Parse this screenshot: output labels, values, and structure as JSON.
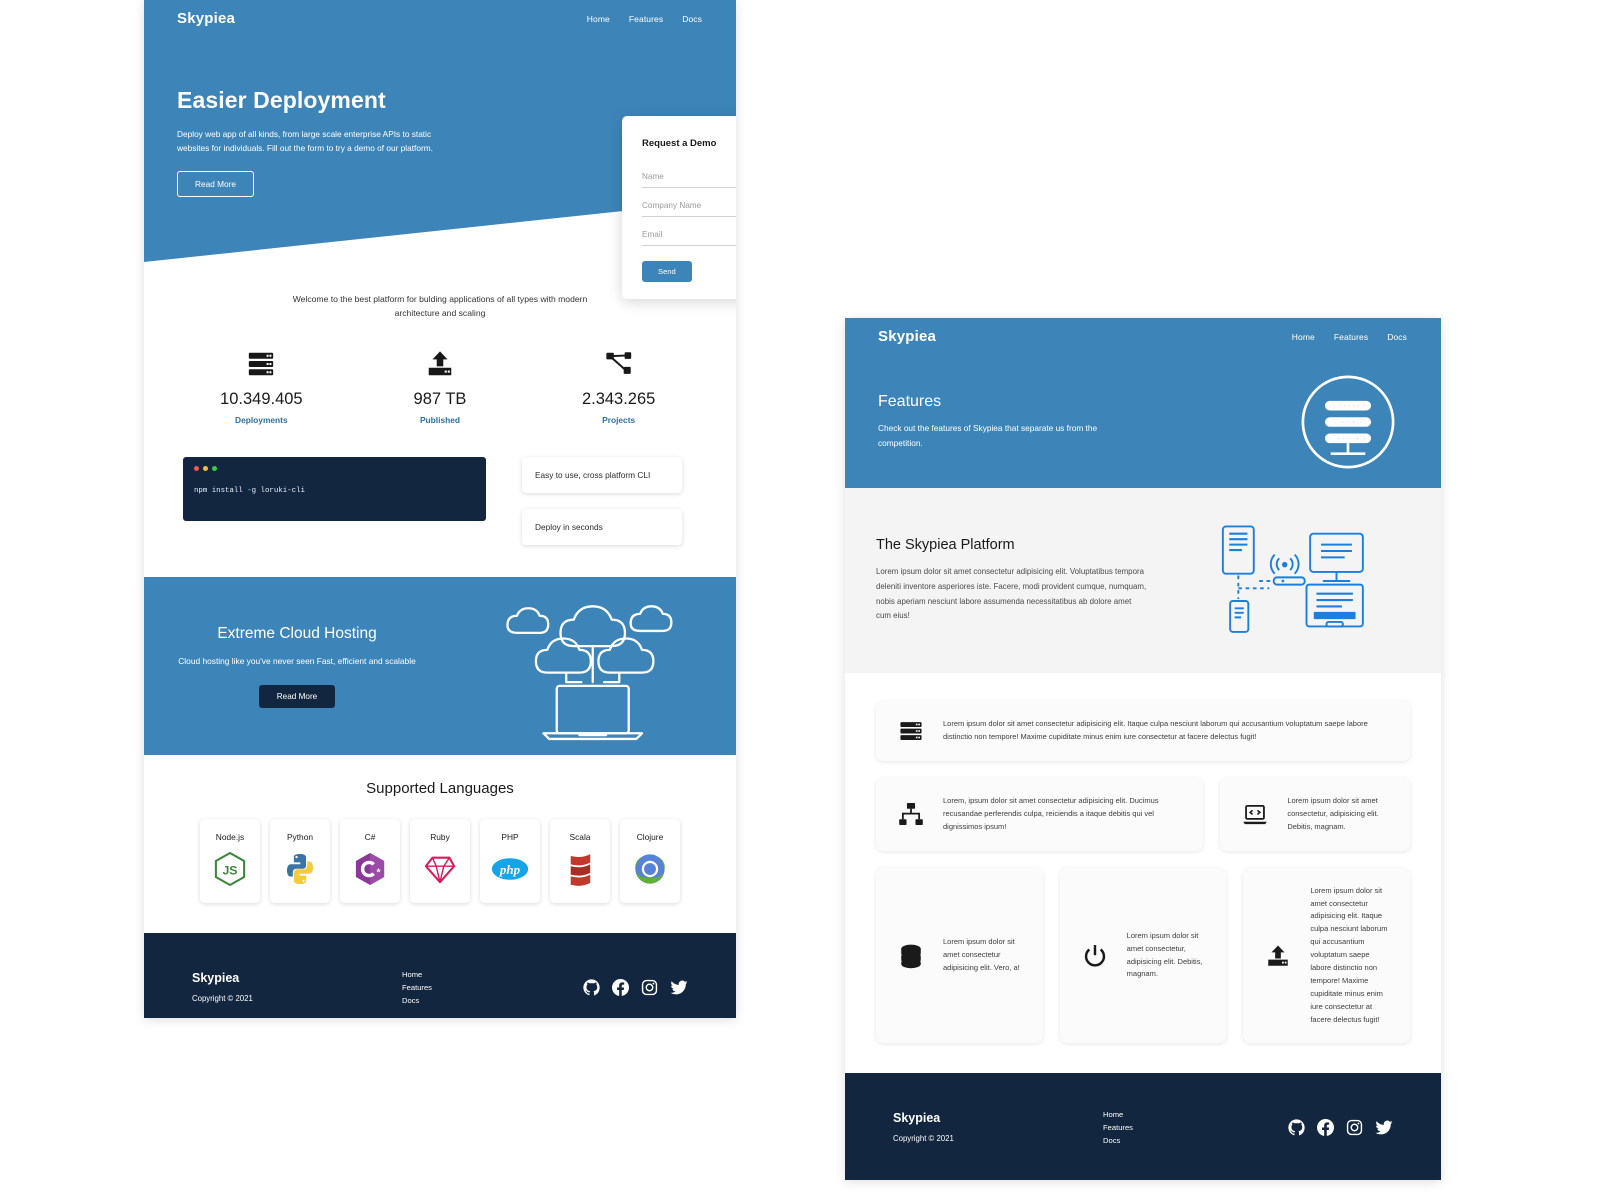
{
  "brand": "Skypiea",
  "nav": {
    "items": [
      "Home",
      "Features",
      "Docs"
    ]
  },
  "home": {
    "hero": {
      "title": "Easier Deployment",
      "body": "Deploy web app of all kinds, from large scale enterprise APIs to static websites for individuals. Fill out the form to try a demo of our platform.",
      "cta": "Read More"
    },
    "form": {
      "title": "Request a Demo",
      "name_placeholder": "Name",
      "company_placeholder": "Company Name",
      "email_placeholder": "Email",
      "name_value": "",
      "company_value": "",
      "email_value": "",
      "submit": "Send"
    },
    "welcome": "Welcome to the best platform for bulding applications of all types with modern architecture and scaling",
    "stats": [
      {
        "icon": "server-stack-icon",
        "number": "10.349.405",
        "label": "Deployments"
      },
      {
        "icon": "upload-icon",
        "number": "987 TB",
        "label": "Published"
      },
      {
        "icon": "network-nodes-icon",
        "number": "2.343.265",
        "label": "Projects"
      }
    ],
    "terminal": {
      "command": "npm install -g loruki-cli"
    },
    "cli_cards": [
      "Easy to use, cross platform CLI",
      "Deploy in seconds"
    ],
    "cloud": {
      "title": "Extreme Cloud Hosting",
      "body": "Cloud hosting like you've never seen Fast, efficient and scalable",
      "cta": "Read More"
    },
    "languages_title": "Supported Languages",
    "languages": [
      {
        "name": "Node.js",
        "icon": "nodejs-icon"
      },
      {
        "name": "Python",
        "icon": "python-icon"
      },
      {
        "name": "C#",
        "icon": "csharp-icon"
      },
      {
        "name": "Ruby",
        "icon": "ruby-icon"
      },
      {
        "name": "PHP",
        "icon": "php-icon"
      },
      {
        "name": "Scala",
        "icon": "scala-icon"
      },
      {
        "name": "Clojure",
        "icon": "clojure-icon"
      }
    ]
  },
  "features": {
    "hero": {
      "title": "Features",
      "body": "Check out the features of Skypiea that separate us from the competition."
    },
    "platform": {
      "title": "The Skypiea Platform",
      "body": "Lorem ipsum dolor sit amet consectetur adipisicing elit. Voluptatibus tempora deleniti inventore asperiores iste. Facere, modi provident cumque, numquam, nobis aperiam nesciunt labore assumenda necessitatibus ab dolore amet cum eius!"
    },
    "cards": [
      {
        "icon": "server-stack-icon",
        "text": "Lorem ipsum dolor sit amet consectetur adipisicing elit. Itaque culpa nesciunt laborum qui accusantium voluptatum saepe labore distinctio non tempore! Maxime cupiditate minus enim iure consectetur at facere delectus fugit!"
      },
      {
        "icon": "sitemap-icon",
        "text": "Lorem, ipsum dolor sit amet consectetur adipisicing elit. Ducimus recusandae perferendis culpa, reiciendis a itaque debitis qui vel dignissimos ipsum!"
      },
      {
        "icon": "laptop-code-icon",
        "text": "Lorem ipsum dolor sit amet consectetur, adipisicing elit. Debitis, magnam."
      },
      {
        "icon": "database-icon",
        "text": "Lorem ipsum dolor sit amet consectetur adipisicing elit. Vero, a!"
      },
      {
        "icon": "power-icon",
        "text": "Lorem ipsum dolor sit amet consectetur, adipisicing elit. Debitis, magnam."
      },
      {
        "icon": "upload-icon",
        "text": "Lorem ipsum dolor sit amet consectetur adipisicing elit. Itaque culpa nesciunt laborum qui accusantium voluptatum saepe labore distinctio non tempore! Maxime cupiditate minus enim iure consectetur at facere delectus fugit!"
      }
    ]
  },
  "footer": {
    "brand": "Skypiea",
    "copyright": "Copyright © 2021",
    "links": [
      "Home",
      "Features",
      "Docs"
    ],
    "social": [
      "github-icon",
      "facebook-icon",
      "instagram-icon",
      "twitter-icon"
    ]
  },
  "colors": {
    "primary": "#3d85b8",
    "dark": "#12263f",
    "light": "#f4f4f4",
    "accent_text": "#2f6f9e"
  }
}
